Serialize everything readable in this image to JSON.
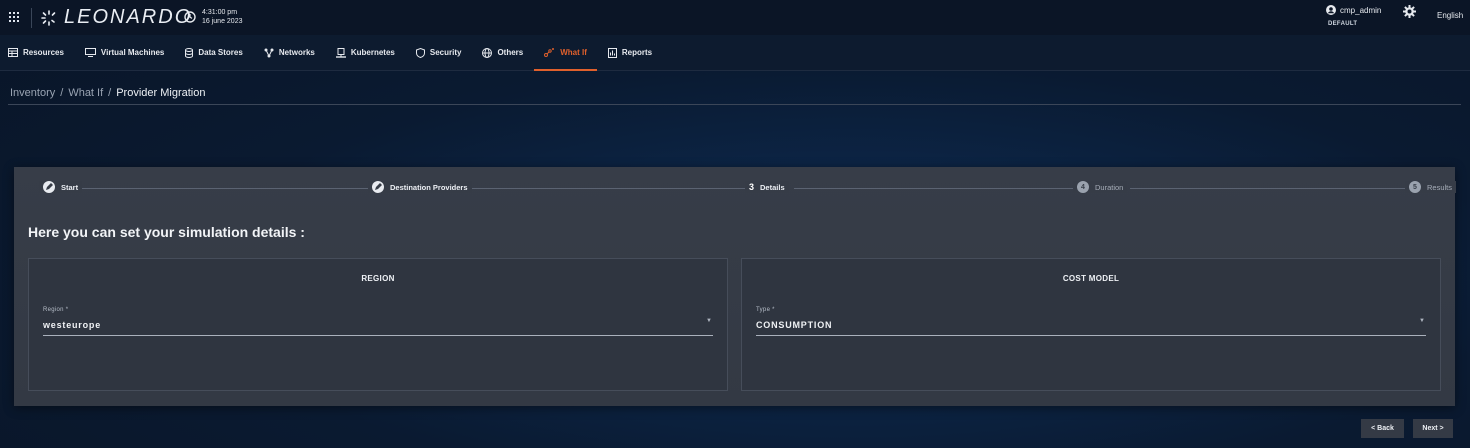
{
  "topbar": {
    "logo_text": "LEONARDO",
    "time": "4:31:00 pm",
    "date": "16 june 2023",
    "user_name": "cmp_admin",
    "tenant": "DEFAULT",
    "language": "English"
  },
  "nav": {
    "items": [
      {
        "label": "Resources",
        "icon": "resources-icon"
      },
      {
        "label": "Virtual Machines",
        "icon": "monitor-icon"
      },
      {
        "label": "Data Stores",
        "icon": "database-icon"
      },
      {
        "label": "Networks",
        "icon": "network-icon"
      },
      {
        "label": "Kubernetes",
        "icon": "kubernetes-icon"
      },
      {
        "label": "Security",
        "icon": "shield-icon"
      },
      {
        "label": "Others",
        "icon": "globe-icon"
      },
      {
        "label": "What If",
        "icon": "what-if-icon",
        "active": true
      },
      {
        "label": "Reports",
        "icon": "reports-icon"
      }
    ],
    "accent_color": "#e0602c"
  },
  "breadcrumb": {
    "items": [
      "Inventory",
      "What If",
      "Provider Migration"
    ],
    "separator": "/"
  },
  "stepper": {
    "steps": [
      {
        "label": "Start",
        "state": "done",
        "marker": "pencil-icon"
      },
      {
        "label": "Destination Providers",
        "state": "done",
        "marker": "pencil-icon"
      },
      {
        "label": "Details",
        "state": "active",
        "number": "3"
      },
      {
        "label": "Duration",
        "state": "pending",
        "number": "4"
      },
      {
        "label": "Results",
        "state": "pending",
        "number": "5"
      }
    ]
  },
  "main": {
    "heading": "Here you can set your simulation details :",
    "region_panel": {
      "title": "REGION",
      "field_label": "Region *",
      "field_value": "westeurope"
    },
    "cost_panel": {
      "title": "COST MODEL",
      "field_label": "Type *",
      "field_value": "CONSUMPTION"
    }
  },
  "footer": {
    "back_label": "< Back",
    "next_label": "Next >"
  }
}
